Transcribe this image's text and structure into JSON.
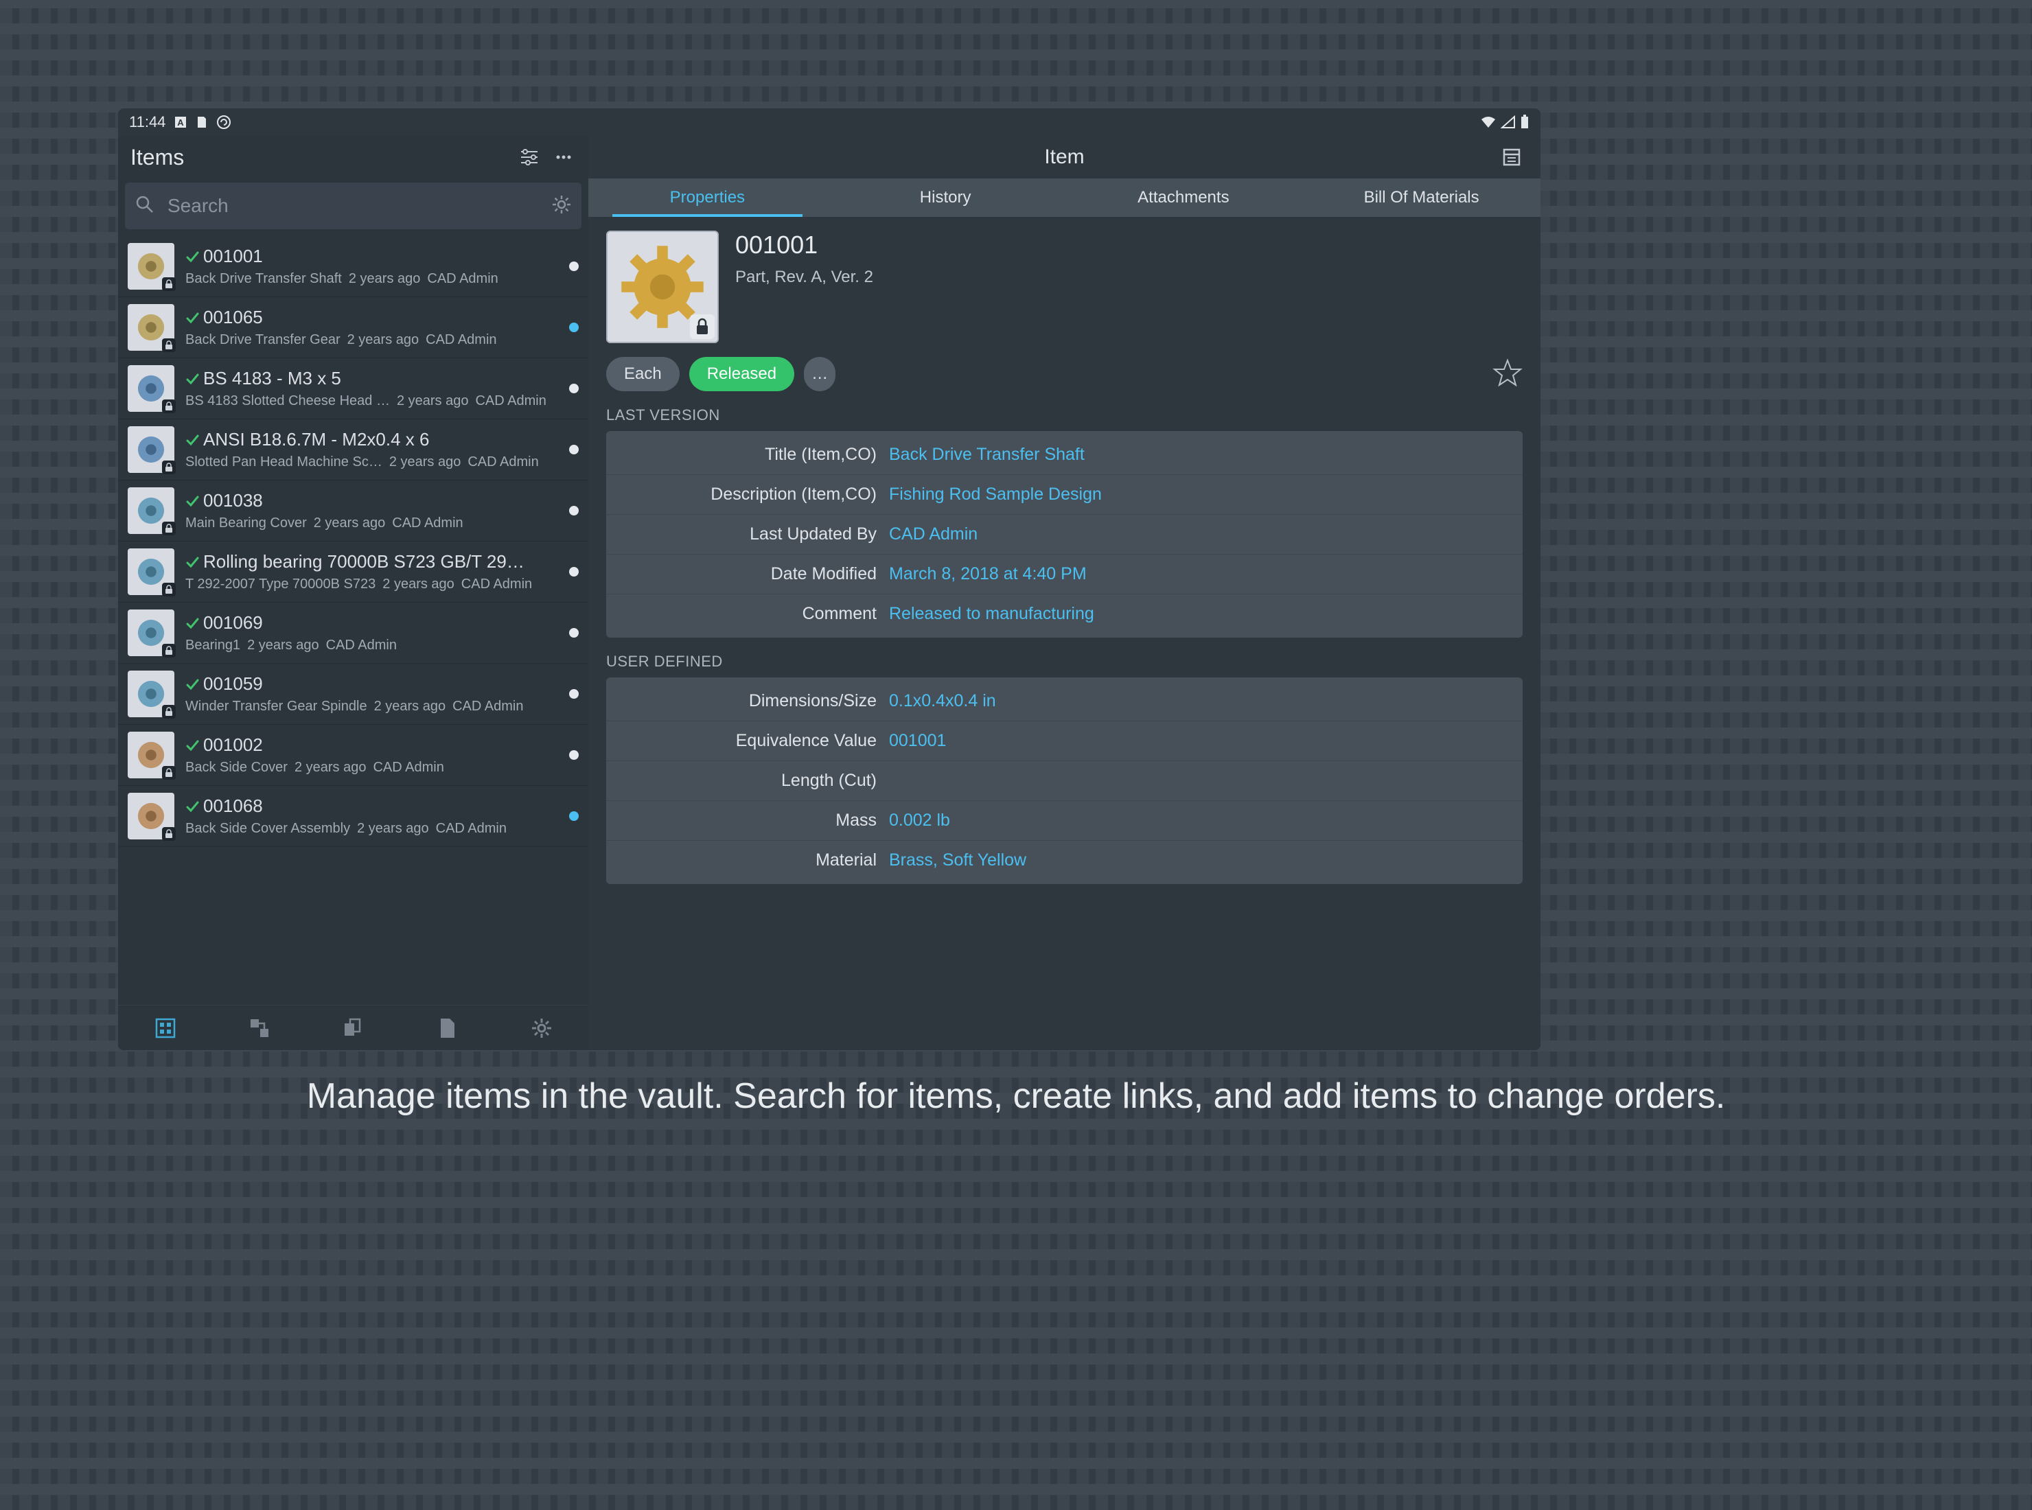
{
  "status": {
    "time": "11:44"
  },
  "sidebar": {
    "title": "Items",
    "search_placeholder": "Search",
    "items": [
      {
        "title": "001001",
        "desc": "Back Drive Transfer Shaft",
        "age": "2 years ago",
        "who": "CAD Admin",
        "dot": "white",
        "thumbHue": 45
      },
      {
        "title": "001065",
        "desc": "Back Drive Transfer Gear",
        "age": "2 years ago",
        "who": "CAD Admin",
        "dot": "blue",
        "thumbHue": 45
      },
      {
        "title": "BS 4183 - M3 x 5",
        "desc": "BS 4183 Slotted Cheese Head …",
        "age": "2 years ago",
        "who": "CAD Admin",
        "dot": "white",
        "thumbHue": 210
      },
      {
        "title": "ANSI B18.6.7M - M2x0.4 x 6",
        "desc": "Slotted Pan Head Machine Sc…",
        "age": "2 years ago",
        "who": "CAD Admin",
        "dot": "white",
        "thumbHue": 210
      },
      {
        "title": "001038",
        "desc": "Main Bearing Cover",
        "age": "2 years ago",
        "who": "CAD Admin",
        "dot": "white",
        "thumbHue": 200
      },
      {
        "title": "Rolling bearing 70000B S723 GB/T 29…",
        "desc": "T 292-2007 Type 70000B S723",
        "age": "2 years ago",
        "who": "CAD Admin",
        "dot": "white",
        "thumbHue": 200
      },
      {
        "title": "001069",
        "desc": "Bearing1",
        "age": "2 years ago",
        "who": "CAD Admin",
        "dot": "white",
        "thumbHue": 200
      },
      {
        "title": "001059",
        "desc": "Winder Transfer Gear Spindle",
        "age": "2 years ago",
        "who": "CAD Admin",
        "dot": "white",
        "thumbHue": 200
      },
      {
        "title": "001002",
        "desc": "Back Side Cover",
        "age": "2 years ago",
        "who": "CAD Admin",
        "dot": "white",
        "thumbHue": 30
      },
      {
        "title": "001068",
        "desc": "Back Side Cover Assembly",
        "age": "2 years ago",
        "who": "CAD Admin",
        "dot": "blue",
        "thumbHue": 30
      }
    ]
  },
  "detail": {
    "header_title": "Item",
    "tabs": [
      "Properties",
      "History",
      "Attachments",
      "Bill Of Materials"
    ],
    "active_tab": 0,
    "item_number": "001001",
    "item_sub": "Part, Rev. A, Ver. 2",
    "chips": {
      "unit": "Each",
      "state": "Released",
      "more": "…"
    },
    "sections": {
      "last_version_label": "LAST VERSION",
      "user_defined_label": "USER DEFINED"
    },
    "last_version": [
      {
        "label": "Title (Item,CO)",
        "value": "Back Drive Transfer Shaft"
      },
      {
        "label": "Description (Item,CO)",
        "value": "Fishing Rod Sample Design"
      },
      {
        "label": "Last Updated By",
        "value": "CAD Admin"
      },
      {
        "label": "Date Modified",
        "value": "March 8, 2018 at 4:40 PM"
      },
      {
        "label": "Comment",
        "value": "Released to manufacturing"
      }
    ],
    "user_defined": [
      {
        "label": "Dimensions/Size",
        "value": "0.1x0.4x0.4 in"
      },
      {
        "label": "Equivalence Value",
        "value": "001001"
      },
      {
        "label": "Length (Cut)",
        "value": ""
      },
      {
        "label": "Mass",
        "value": "0.002 lb"
      },
      {
        "label": "Material",
        "value": "Brass, Soft Yellow"
      }
    ]
  },
  "caption": "Manage items in the vault. Search for items, create links, and add items to change orders."
}
